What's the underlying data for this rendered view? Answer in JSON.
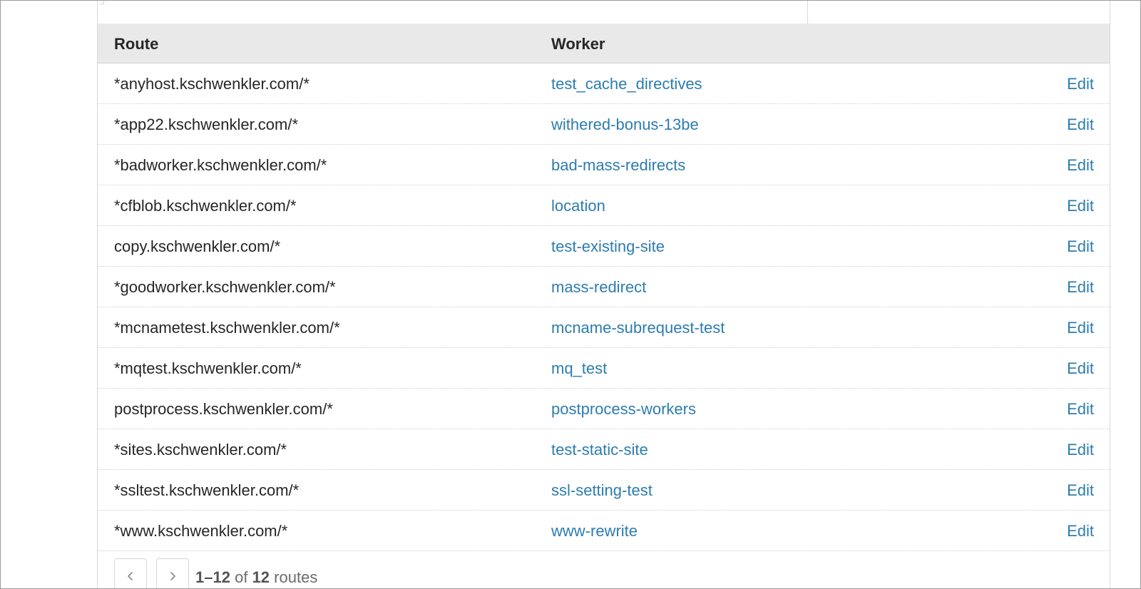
{
  "table": {
    "headers": {
      "route": "Route",
      "worker": "Worker"
    },
    "rows": [
      {
        "route": "*anyhost.kschwenkler.com/*",
        "worker": "test_cache_directives",
        "action": "Edit"
      },
      {
        "route": "*app22.kschwenkler.com/*",
        "worker": "withered-bonus-13be",
        "action": "Edit"
      },
      {
        "route": "*badworker.kschwenkler.com/*",
        "worker": "bad-mass-redirects",
        "action": "Edit"
      },
      {
        "route": "*cfblob.kschwenkler.com/*",
        "worker": "location",
        "action": "Edit"
      },
      {
        "route": "copy.kschwenkler.com/*",
        "worker": "test-existing-site",
        "action": "Edit"
      },
      {
        "route": "*goodworker.kschwenkler.com/*",
        "worker": "mass-redirect",
        "action": "Edit"
      },
      {
        "route": "*mcnametest.kschwenkler.com/*",
        "worker": "mcname-subrequest-test",
        "action": "Edit"
      },
      {
        "route": "*mqtest.kschwenkler.com/*",
        "worker": "mq_test",
        "action": "Edit"
      },
      {
        "route": "postprocess.kschwenkler.com/*",
        "worker": "postprocess-workers",
        "action": "Edit"
      },
      {
        "route": "*sites.kschwenkler.com/*",
        "worker": "test-static-site",
        "action": "Edit"
      },
      {
        "route": "*ssltest.kschwenkler.com/*",
        "worker": "ssl-setting-test",
        "action": "Edit"
      },
      {
        "route": "*www.kschwenkler.com/*",
        "worker": "www-rewrite",
        "action": "Edit"
      }
    ]
  },
  "pagination": {
    "range": "1–12",
    "of_label": "of",
    "total": "12",
    "unit": "routes",
    "prev_icon": "chevron-left-icon",
    "next_icon": "chevron-right-icon"
  },
  "colors": {
    "link": "#2c7cb0",
    "header_bg": "#e8e9e8"
  }
}
